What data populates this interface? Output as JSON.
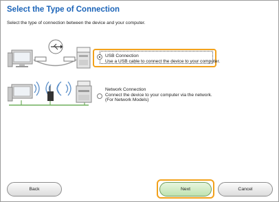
{
  "header": {
    "title": "Select the Type of Connection",
    "subtitle": "Select the type of connection between the device and your computer."
  },
  "options": [
    {
      "title": "USB Connection",
      "description": "Use a USB cable to connect the device to your computer.",
      "selected": true
    },
    {
      "title": "Network Connection",
      "description": "Connect the device to your computer via the network.",
      "note": "(For Network Models)",
      "selected": false
    }
  ],
  "buttons": {
    "back": "Back",
    "next": "Next",
    "cancel": "Cancel"
  },
  "colors": {
    "title": "#1a63b8",
    "highlight": "#f2a11a",
    "next_button": "#bfe2b0"
  },
  "icons": [
    "usb-connection-illustration",
    "network-connection-illustration"
  ]
}
